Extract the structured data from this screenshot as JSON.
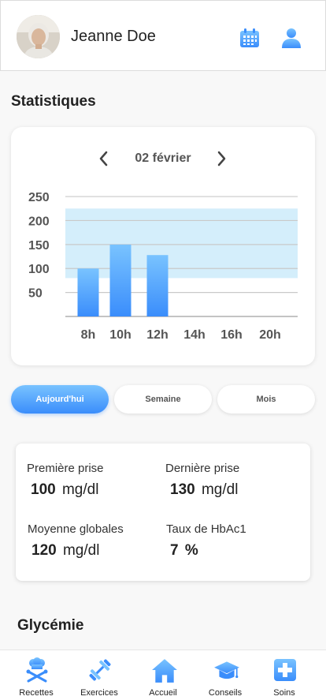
{
  "header": {
    "user_name": "Jeanne Doe",
    "icons": [
      "calendar-icon",
      "profile-icon"
    ]
  },
  "statistics": {
    "title": "Statistiques",
    "date_label": "02 février",
    "chart_data": {
      "type": "bar",
      "categories": [
        "8h",
        "10h",
        "12h",
        "14h",
        "16h",
        "20h"
      ],
      "values": [
        100,
        150,
        128,
        null,
        null,
        null
      ],
      "yticks": [
        50,
        100,
        150,
        200,
        250
      ],
      "ylim": [
        0,
        260
      ],
      "target_band": [
        80,
        225
      ],
      "grid": true,
      "colors": {
        "bar_top": "#79c3ff",
        "bar_bottom": "#3a8dfb",
        "band": "#d4eefb"
      }
    }
  },
  "period_buttons": {
    "today": "Aujourd'hui",
    "week": "Semaine",
    "month": "Mois",
    "active": "today"
  },
  "summary": {
    "first": {
      "label": "Première prise",
      "value": "100",
      "unit": "mg/dl"
    },
    "last": {
      "label": "Dernière prise",
      "value": "130",
      "unit": "mg/dl"
    },
    "average": {
      "label": "Moyenne globales",
      "value": "120",
      "unit": "mg/dl"
    },
    "hba1c": {
      "label": "Taux de HbAc1",
      "value": "7",
      "unit": "%"
    }
  },
  "glycemia": {
    "title": "Glycémie"
  },
  "tabbar": {
    "items": [
      {
        "label": "Recettes",
        "icon": "chef-hat-icon"
      },
      {
        "label": "Exercices",
        "icon": "dumbbell-icon"
      },
      {
        "label": "Accueil",
        "icon": "home-icon"
      },
      {
        "label": "Conseils",
        "icon": "graduation-cap-icon"
      },
      {
        "label": "Soins",
        "icon": "medical-cross-icon"
      }
    ]
  },
  "colors": {
    "accent": "#3a8dfb",
    "accent_light": "#79c3ff"
  }
}
